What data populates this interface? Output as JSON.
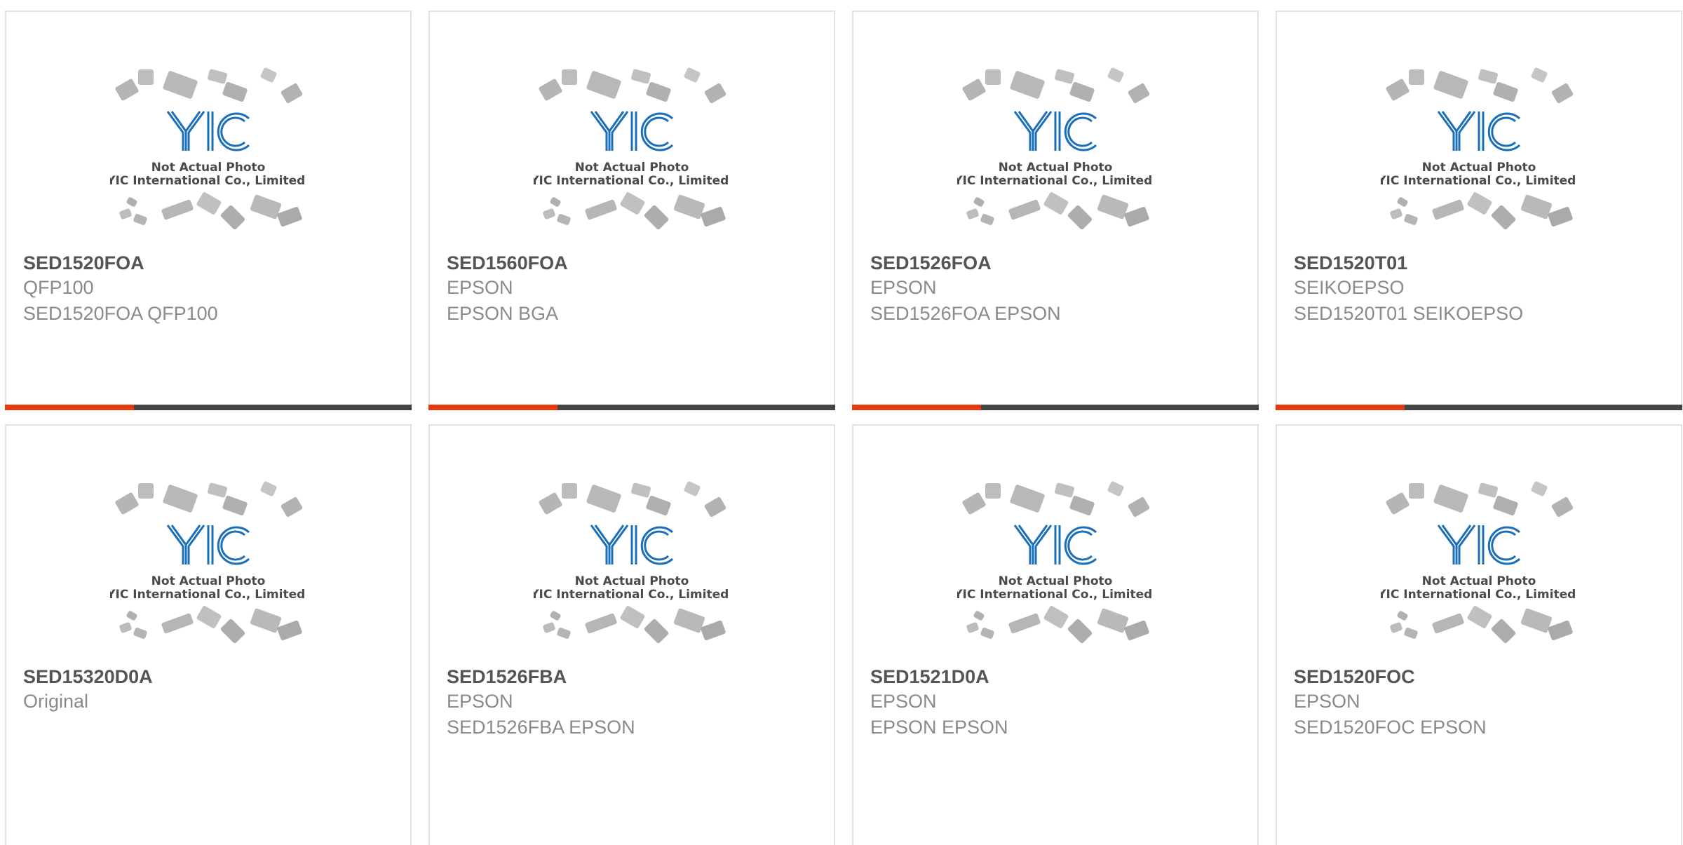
{
  "watermark": {
    "logo_text": "YIC",
    "line1": "Not Actual Photo",
    "line2": "YIC International Co., Limited."
  },
  "colors": {
    "accent": "#e8380d",
    "bar": "#444444",
    "logo": "#1a6fb8",
    "title": "#555555",
    "subtext": "#8a8a8a"
  },
  "products": [
    {
      "part": "SED1520FOA",
      "line1": "QFP100",
      "line2": "SED1520FOA QFP100"
    },
    {
      "part": "SED1560FOA",
      "line1": "EPSON",
      "line2": "EPSON BGA"
    },
    {
      "part": "SED1526FOA",
      "line1": "EPSON",
      "line2": "SED1526FOA EPSON"
    },
    {
      "part": "SED1520T01",
      "line1": "SEIKOEPSO",
      "line2": "SED1520T01 SEIKOEPSO"
    },
    {
      "part": "SED15320D0A",
      "line1": "Original",
      "line2": ""
    },
    {
      "part": "SED1526FBA",
      "line1": "EPSON",
      "line2": "SED1526FBA EPSON"
    },
    {
      "part": "SED1521D0A",
      "line1": "EPSON",
      "line2": "EPSON EPSON"
    },
    {
      "part": "SED1520FOC",
      "line1": "EPSON",
      "line2": "SED1520FOC EPSON"
    }
  ]
}
